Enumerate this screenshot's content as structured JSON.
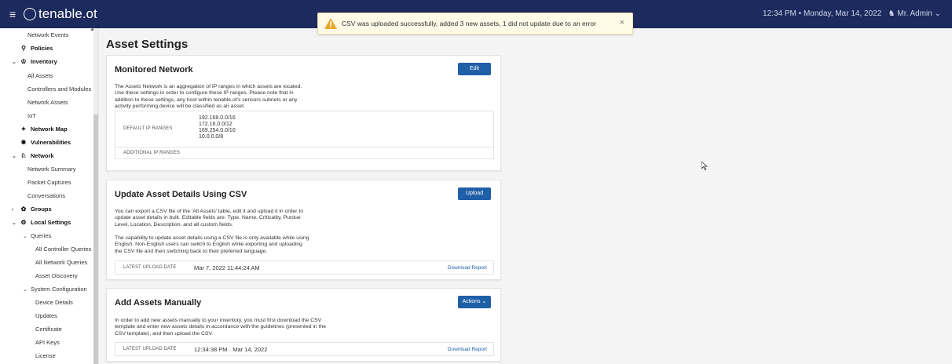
{
  "topbar": {
    "menu_icon": "hamburger-icon",
    "brand": "tenable.ot",
    "time": "12:34 PM",
    "separator": "•",
    "date": "Monday, Mar 14, 2022",
    "user": "Mr. Admin"
  },
  "toast": {
    "message": "CSV was uploaded successfully, added 3 new assets, 1 did not update due to an error",
    "close": "×"
  },
  "sidebar": {
    "items": [
      {
        "label": "Network Events"
      },
      {
        "label": "Policies"
      },
      {
        "label": "Inventory"
      },
      {
        "label": "All Assets"
      },
      {
        "label": "Controllers and Modules"
      },
      {
        "label": "Network Assets"
      },
      {
        "label": "IoT"
      },
      {
        "label": "Network Map"
      },
      {
        "label": "Vulnerabilities"
      },
      {
        "label": "Network"
      },
      {
        "label": "Network Summary"
      },
      {
        "label": "Packet Captures"
      },
      {
        "label": "Conversations"
      },
      {
        "label": "Groups"
      },
      {
        "label": "Local Settings"
      },
      {
        "label": "Queries"
      },
      {
        "label": "All Controller Queries"
      },
      {
        "label": "All Network Queries"
      },
      {
        "label": "Asset Discovery"
      },
      {
        "label": "System Configuration"
      },
      {
        "label": "Device Details"
      },
      {
        "label": "Updates"
      },
      {
        "label": "Certificate"
      },
      {
        "label": "API Keys"
      },
      {
        "label": "License"
      }
    ]
  },
  "page": {
    "title": "Asset Settings"
  },
  "monitored": {
    "title": "Monitored Network",
    "button": "Edit",
    "description": "The Assets Network is an aggregation of IP ranges in which assets are located. Use these settings in order to configure these IP ranges. Please note that in addition to these settings, any host within tenable.ot's sensors subnets or any activity performing device will be classified as an asset.",
    "default_label": "DEFAULT IP RANGES",
    "ranges": [
      "192.168.0.0/16",
      "172.16.0.0/12",
      "169.254.0.0/16",
      "10.0.0.0/8"
    ],
    "additional_label": "ADDITIONAL IP RANGES"
  },
  "csv": {
    "title": "Update Asset Details Using CSV",
    "button": "Upload",
    "description1": "You can export a CSV file of the 'All Assets' table, edit it and upload it in order to update asset details in bulk. Editable fields are: Type, Name, Criticality, Purdue Level, Location, Description, and all custom fields.",
    "description2": "The capability to update asset details using a CSV file is only available while using English. Non-English users can switch to English while exporting and uploading the CSV file and then switching back to their preferred language.",
    "upload_label": "LATEST UPLOAD DATE",
    "upload_value": "Mar 7, 2022 11:44:24 AM",
    "report_link": "Download Report"
  },
  "manual": {
    "title": "Add Assets Manually",
    "button": "Actions",
    "description": "In order to add new assets manually to your inventory, you must first download the CSV template and enter new assets details in accordance with the guidelines (presented in the CSV template), and then upload the CSV.",
    "upload_label": "LATEST UPLOAD DATE",
    "upload_value": "12:34:38 PM · Mar 14, 2022",
    "report_link": "Download Report"
  }
}
